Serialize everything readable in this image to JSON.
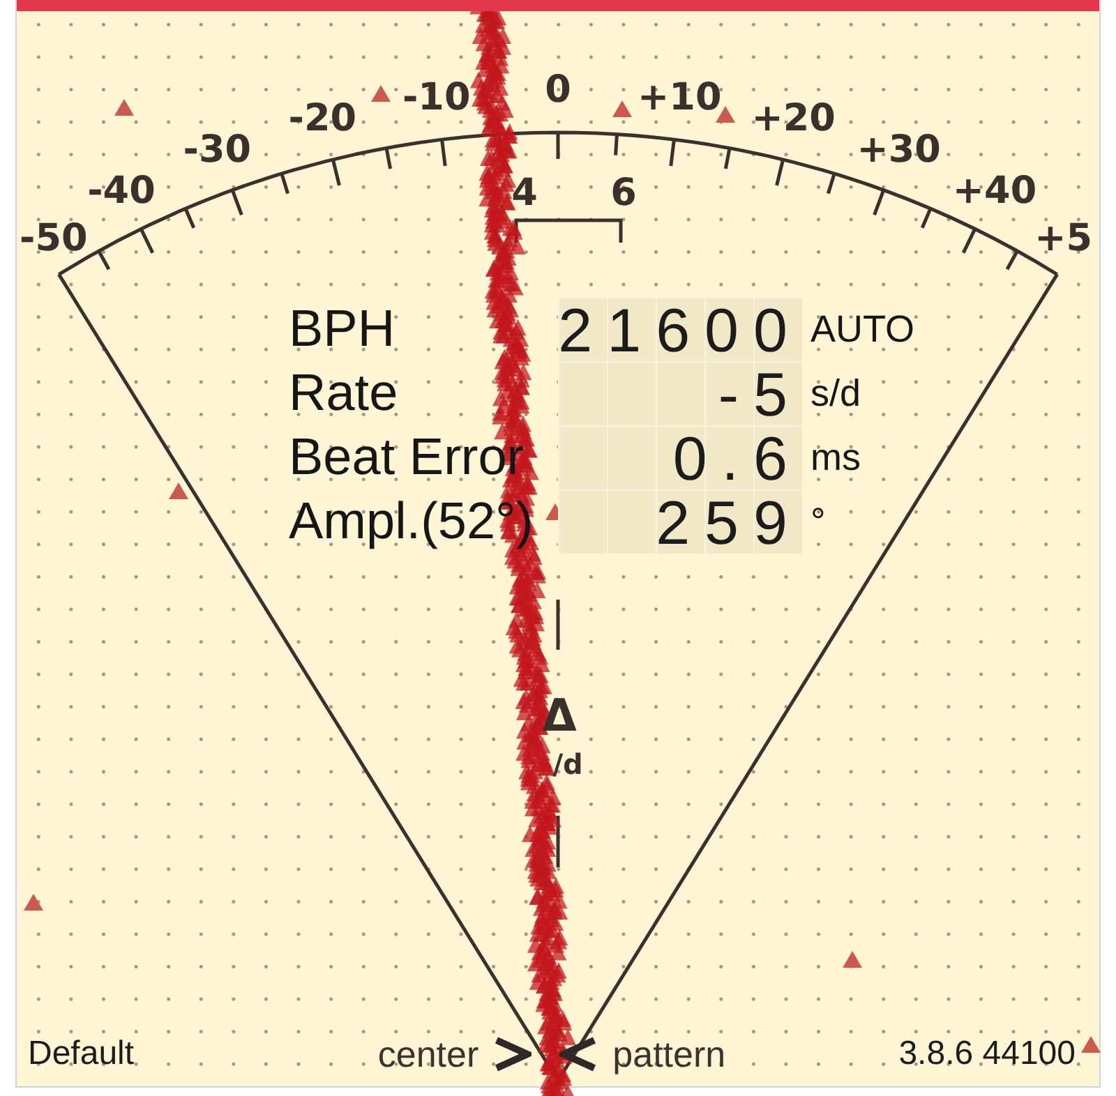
{
  "scale": {
    "labels": [
      "-50",
      "-40",
      "-30",
      "-20",
      "-10",
      "0",
      "+10",
      "+20",
      "+30",
      "+40",
      "+5"
    ],
    "beat_error_labels": [
      "4",
      "6"
    ]
  },
  "readings": [
    {
      "label": "BPH",
      "value": "21600",
      "unit": "AUTO"
    },
    {
      "label": "Rate",
      "value": "-5",
      "unit": "s/d"
    },
    {
      "label": "Beat Error",
      "value": "0.6",
      "unit": "ms"
    },
    {
      "label": "Ampl.(52°)",
      "value": "259",
      "unit": "°"
    }
  ],
  "rate_marker": {
    "symbol": "Δ",
    "unit": "/d"
  },
  "footer": {
    "profile": "Default",
    "center_button": "center",
    "pattern_button": "pattern",
    "version": "3.8.6 44100"
  }
}
